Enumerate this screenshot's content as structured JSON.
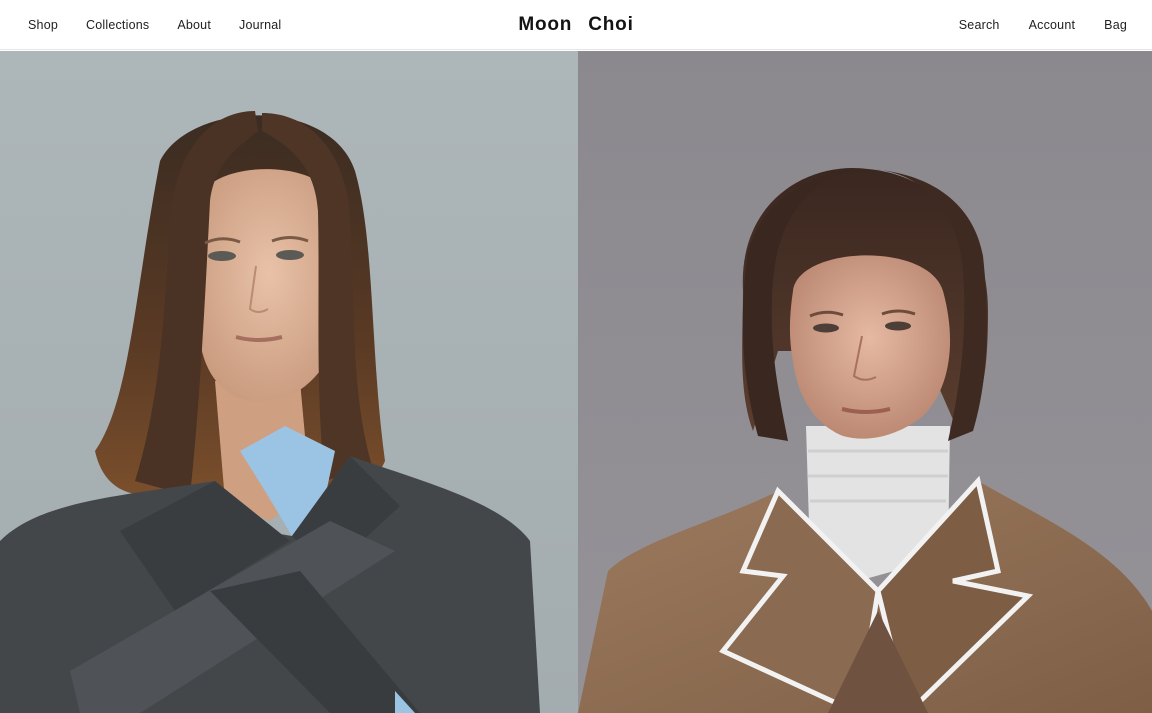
{
  "brand": {
    "name": "Moon Choi"
  },
  "nav_left": [
    {
      "label": "Shop"
    },
    {
      "label": "Collections"
    },
    {
      "label": "About"
    },
    {
      "label": "Journal"
    }
  ],
  "nav_right": [
    {
      "label": "Search"
    },
    {
      "label": "Account"
    },
    {
      "label": "Bag"
    }
  ],
  "hero": {
    "left_image": {
      "subject": "model-with-long-brown-hair-grey-wrap-blazer-blue-shirt",
      "background_color": "#a9b2b5"
    },
    "right_image": {
      "subject": "model-with-bob-haircut-camel-coat-white-turtleneck",
      "background_color": "#8f8d92"
    }
  },
  "colors": {
    "header_bg": "#ffffff",
    "text": "#1a1a1a",
    "divider": "#e6e6e6"
  }
}
